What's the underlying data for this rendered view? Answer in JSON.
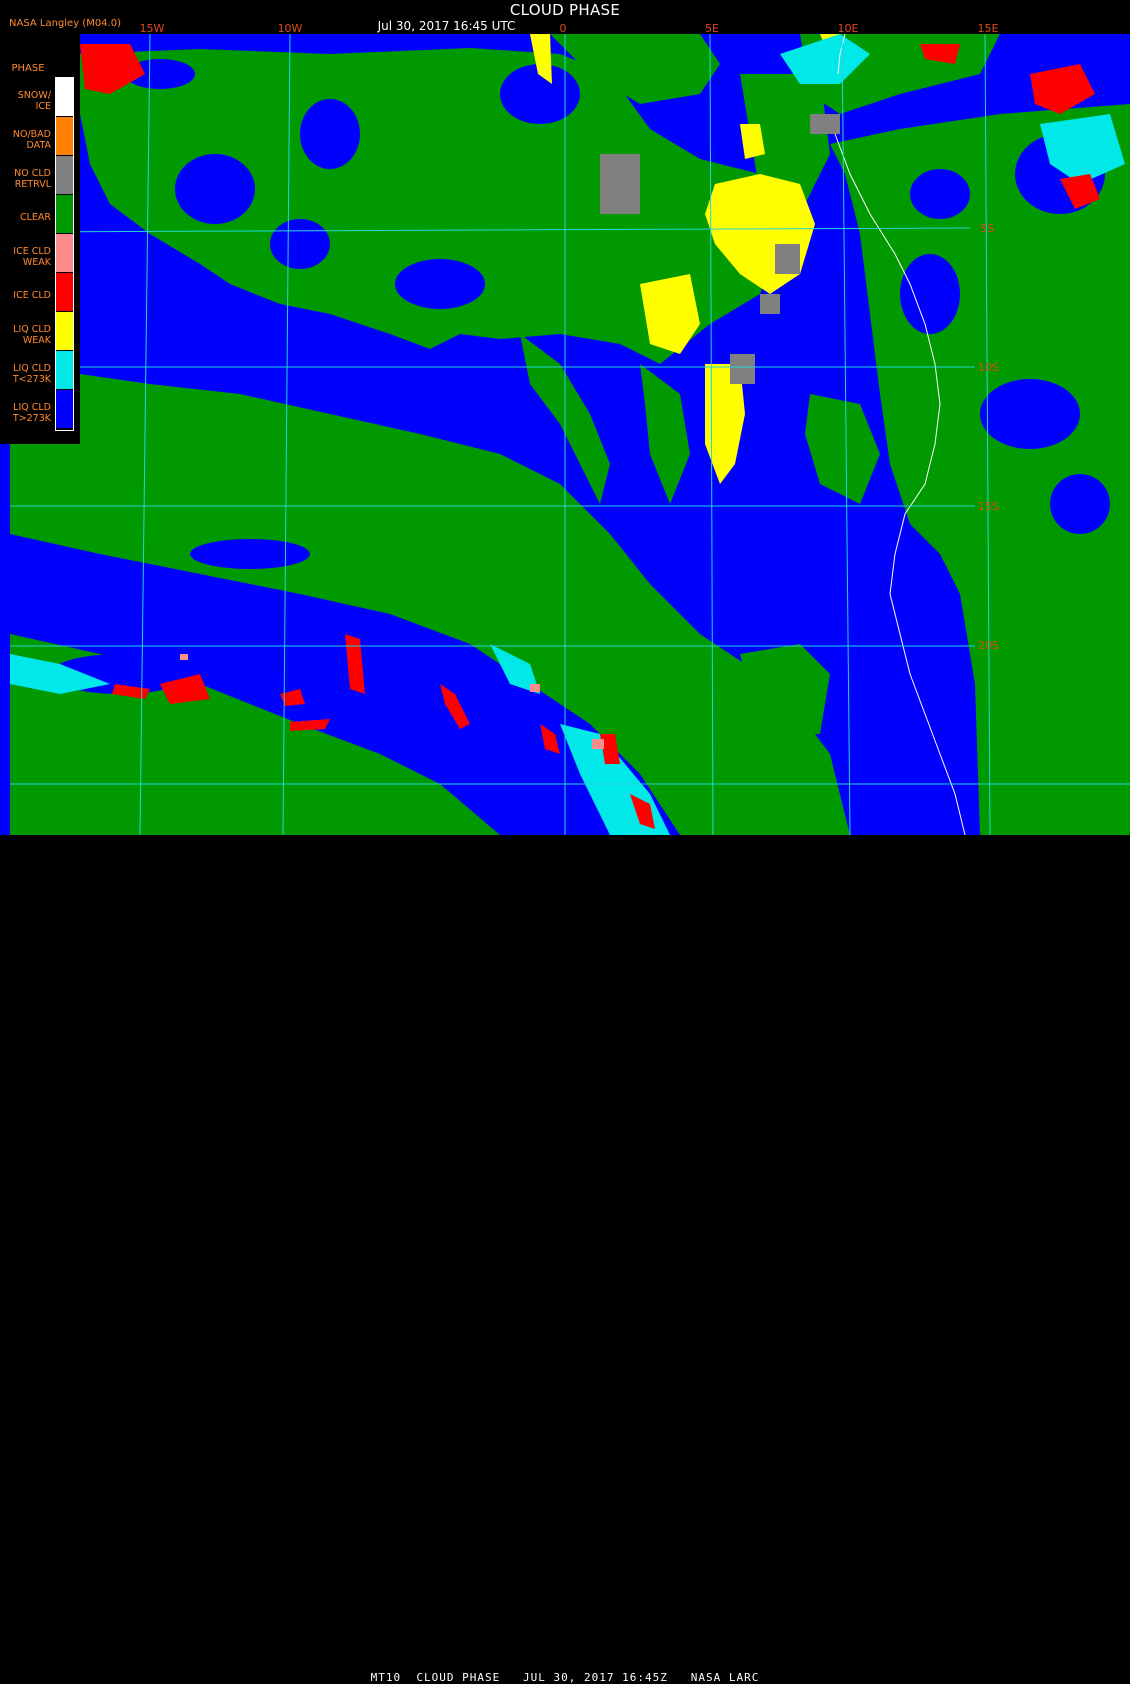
{
  "header": {
    "title": "CLOUD PHASE",
    "timestamp": "Jul 30, 2017 16:45 UTC",
    "credit": "NASA Langley (M04.0)"
  },
  "footer": {
    "text": "MT10  CLOUD PHASE   JUL 30, 2017 16:45Z   NASA LARC"
  },
  "grid": {
    "lon_labels": [
      "15W",
      "10W",
      "0",
      "5E",
      "10E",
      "15E"
    ],
    "lat_labels": [
      "5S",
      "10S",
      "15S",
      "20S"
    ]
  },
  "legend": {
    "title": "PHASE",
    "items": [
      {
        "line1": "SNOW/",
        "line2": "ICE",
        "color": "#ffffff"
      },
      {
        "line1": "NO/BAD",
        "line2": "DATA",
        "color": "#ff8000"
      },
      {
        "line1": "NO CLD",
        "line2": "RETRVL",
        "color": "#808080"
      },
      {
        "line1": "CLEAR",
        "line2": "",
        "color": "#009900"
      },
      {
        "line1": "ICE CLD",
        "line2": "WEAK",
        "color": "#ff8c8c"
      },
      {
        "line1": "ICE CLD",
        "line2": "",
        "color": "#ff0000"
      },
      {
        "line1": "LIQ CLD",
        "line2": "WEAK",
        "color": "#ffff00"
      },
      {
        "line1": "LIQ CLD",
        "line2": "T<273K",
        "color": "#00e8e8"
      },
      {
        "line1": "LIQ CLD",
        "line2": "T>273K",
        "color": "#0000ff"
      }
    ]
  },
  "colors": {
    "ocean_liquid": "#0000ff",
    "clear": "#009900",
    "liquid_weak": "#ffff00",
    "no_retrieval": "#808080",
    "ice": "#ff0000",
    "ice_weak": "#ff8c8c",
    "liquid_cold": "#00e8e8",
    "snow_ice": "#ffffff",
    "grid_line": "#22d6d6",
    "label": "#e04a1a"
  }
}
